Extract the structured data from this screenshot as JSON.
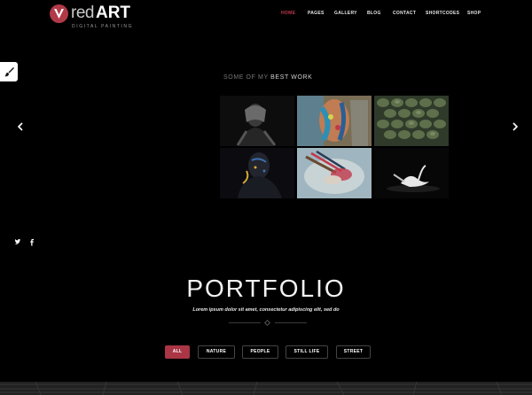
{
  "logo": {
    "word1": "red",
    "word2": "ART",
    "tagline": "DIGITAL PAINTING"
  },
  "nav": {
    "items": [
      {
        "label": "HOME",
        "active": true
      },
      {
        "label": "PAGES",
        "active": false
      },
      {
        "label": "GALLERY",
        "active": false
      },
      {
        "label": "BLOG",
        "active": false
      },
      {
        "label": "CONTACT",
        "active": false
      },
      {
        "label": "SHORTCODES",
        "active": false
      },
      {
        "label": "SHOP",
        "active": false
      }
    ]
  },
  "hero": {
    "heading_light": "SOME OF MY",
    "heading_bold": "BEST WORK"
  },
  "gallery": {
    "images": [
      {
        "icon": "hands-over-face-image"
      },
      {
        "icon": "painted-face-image"
      },
      {
        "icon": "green-scales-image"
      },
      {
        "icon": "painted-body-image"
      },
      {
        "icon": "paint-brushes-image"
      },
      {
        "icon": "swan-image"
      }
    ]
  },
  "social": {
    "icons": [
      "twitter-icon",
      "facebook-icon"
    ]
  },
  "portfolio": {
    "title": "PORTFOLIO",
    "subtitle": "Lorem ipsum dolor sit amet, consectetur adipiscing elit, sed do",
    "filters": [
      {
        "label": "ALL",
        "active": true
      },
      {
        "label": "NATURE",
        "active": false
      },
      {
        "label": "PEOPLE",
        "active": false
      },
      {
        "label": "STILL LIFE",
        "active": false
      },
      {
        "label": "STREET",
        "active": false
      }
    ]
  },
  "colors": {
    "accent": "#c0394b",
    "background": "#000000",
    "button_active": "#a93545"
  }
}
